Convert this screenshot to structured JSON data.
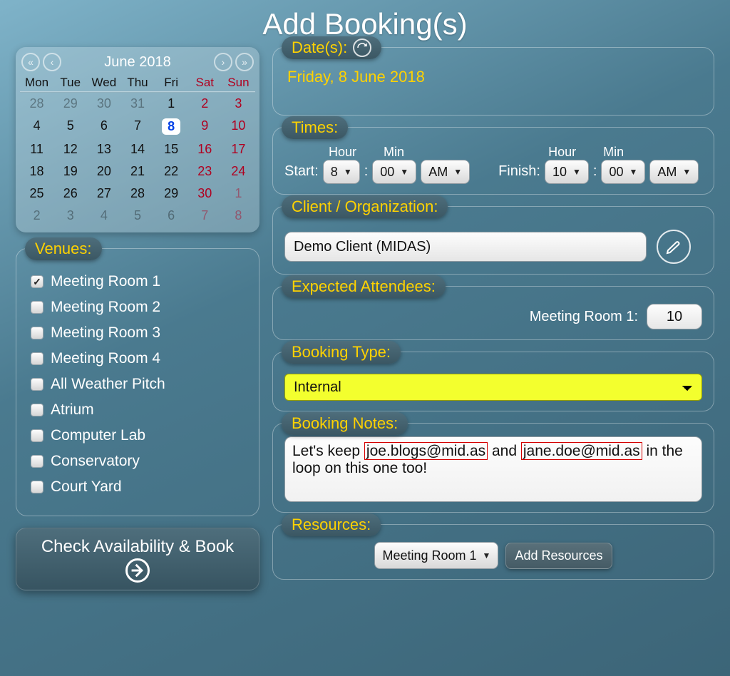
{
  "title": "Add Booking(s)",
  "calendar": {
    "month_label": "June 2018",
    "dow": [
      "Mon",
      "Tue",
      "Wed",
      "Thu",
      "Fri",
      "Sat",
      "Sun"
    ],
    "weeks": [
      [
        {
          "n": 28,
          "other": true
        },
        {
          "n": 29,
          "other": true
        },
        {
          "n": 30,
          "other": true
        },
        {
          "n": 31,
          "other": true
        },
        {
          "n": 1
        },
        {
          "n": 2,
          "weekend": true
        },
        {
          "n": 3,
          "weekend": true
        }
      ],
      [
        {
          "n": 4
        },
        {
          "n": 5
        },
        {
          "n": 6
        },
        {
          "n": 7
        },
        {
          "n": 8,
          "today": true
        },
        {
          "n": 9,
          "weekend": true
        },
        {
          "n": 10,
          "weekend": true
        }
      ],
      [
        {
          "n": 11
        },
        {
          "n": 12
        },
        {
          "n": 13
        },
        {
          "n": 14
        },
        {
          "n": 15
        },
        {
          "n": 16,
          "weekend": true
        },
        {
          "n": 17,
          "weekend": true
        }
      ],
      [
        {
          "n": 18
        },
        {
          "n": 19
        },
        {
          "n": 20
        },
        {
          "n": 21
        },
        {
          "n": 22
        },
        {
          "n": 23,
          "weekend": true
        },
        {
          "n": 24,
          "weekend": true
        }
      ],
      [
        {
          "n": 25
        },
        {
          "n": 26
        },
        {
          "n": 27
        },
        {
          "n": 28
        },
        {
          "n": 29
        },
        {
          "n": 30,
          "weekend": true
        },
        {
          "n": 1,
          "other": true,
          "weekend": true
        }
      ],
      [
        {
          "n": 2,
          "other": true
        },
        {
          "n": 3,
          "other": true
        },
        {
          "n": 4,
          "other": true
        },
        {
          "n": 5,
          "other": true
        },
        {
          "n": 6,
          "other": true
        },
        {
          "n": 7,
          "other": true,
          "weekend": true
        },
        {
          "n": 8,
          "other": true,
          "weekend": true
        }
      ]
    ]
  },
  "venues": {
    "legend": "Venues:",
    "items": [
      {
        "label": "Meeting Room 1",
        "checked": true
      },
      {
        "label": "Meeting Room 2",
        "checked": false
      },
      {
        "label": "Meeting Room 3",
        "checked": false
      },
      {
        "label": "Meeting Room 4",
        "checked": false
      },
      {
        "label": "All Weather Pitch",
        "checked": false
      },
      {
        "label": "Atrium",
        "checked": false
      },
      {
        "label": "Computer Lab",
        "checked": false
      },
      {
        "label": "Conservatory",
        "checked": false
      },
      {
        "label": "Court Yard",
        "checked": false
      }
    ]
  },
  "check_button": "Check Availability & Book",
  "dates": {
    "legend": "Date(s):",
    "value": "Friday, 8 June 2018"
  },
  "times": {
    "legend": "Times:",
    "hour_label": "Hour",
    "min_label": "Min",
    "start_label": "Start:",
    "finish_label": "Finish:",
    "start": {
      "hour": "8",
      "min": "00",
      "ampm": "AM"
    },
    "finish": {
      "hour": "10",
      "min": "00",
      "ampm": "AM"
    }
  },
  "client": {
    "legend": "Client / Organization:",
    "value": "Demo Client (MIDAS)"
  },
  "attendees": {
    "legend": "Expected Attendees:",
    "room_label": "Meeting Room 1:",
    "value": "10"
  },
  "booking_type": {
    "legend": "Booking Type:",
    "value": "Internal"
  },
  "notes": {
    "legend": "Booking Notes:",
    "pre": "Let's keep ",
    "email1": "joe.blogs@mid.as",
    "mid": " and ",
    "email2": "jane.doe@mid.as",
    "post": " in the loop on this one too!"
  },
  "resources": {
    "legend": "Resources:",
    "selected": "Meeting Room 1",
    "button": "Add Resources"
  }
}
